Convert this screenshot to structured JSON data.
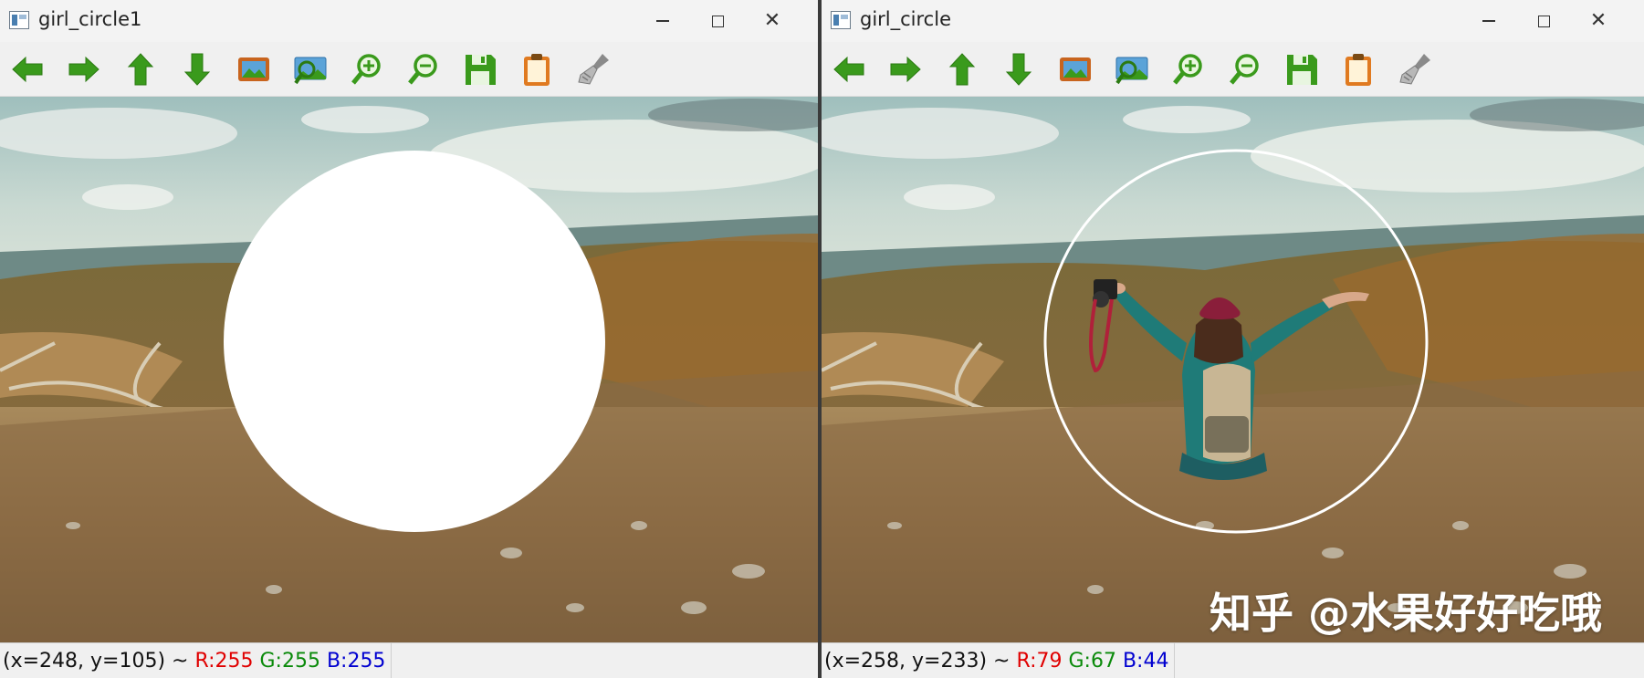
{
  "windows": [
    {
      "title": "girl_circle1",
      "status": {
        "coords": "(x=248, y=105) ~",
        "r": "R:255",
        "g": "G:255",
        "b": "B:255"
      }
    },
    {
      "title": "girl_circle",
      "status": {
        "coords": "(x=258, y=233) ~",
        "r": "R:79",
        "g": "G:67",
        "b": "B:44"
      }
    }
  ],
  "toolbar_icons": [
    "arrow-left-icon",
    "arrow-right-icon",
    "arrow-up-icon",
    "arrow-down-icon",
    "image-icon",
    "zoom-fit-icon",
    "zoom-in-icon",
    "zoom-out-icon",
    "save-icon",
    "clipboard-icon",
    "brush-icon"
  ],
  "watermark": "知乎 @水果好好吃哦",
  "colors": {
    "toolbar_green": "#3a9a1c",
    "status_red": "#e00000",
    "status_green": "#0a8a0a",
    "status_blue": "#0000d0"
  }
}
